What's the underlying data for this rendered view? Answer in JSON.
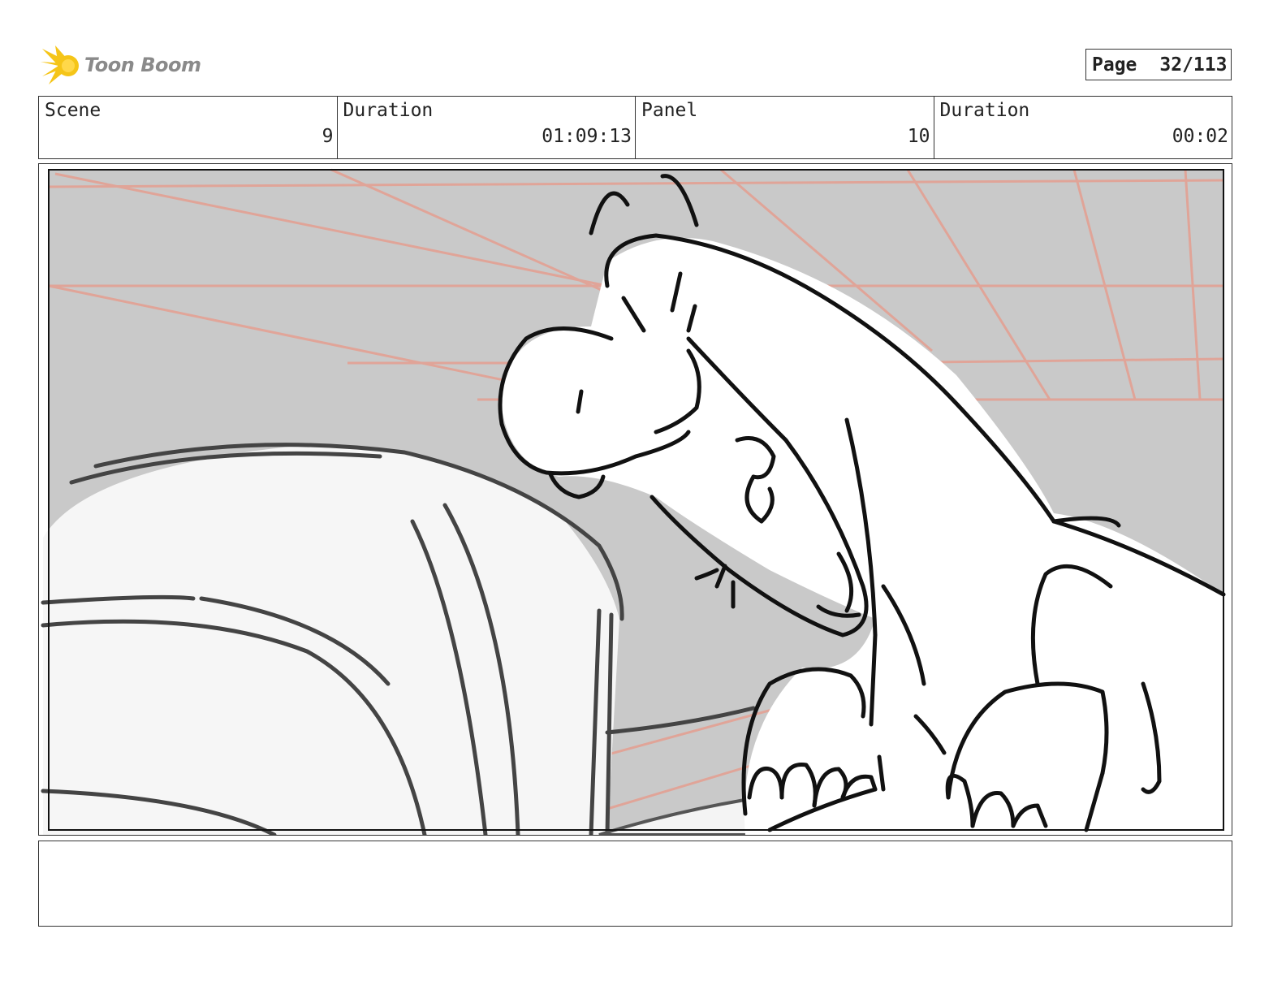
{
  "brand": {
    "logo_text": "Toon Boom",
    "accent": "#f5c518"
  },
  "page": {
    "label": "Page",
    "number": "32/113"
  },
  "info": [
    {
      "label": "Scene",
      "value": "9"
    },
    {
      "label": "Duration",
      "value": "01:09:13"
    },
    {
      "label": "Panel",
      "value": "10"
    },
    {
      "label": "Duration",
      "value": "00:02"
    }
  ],
  "panel_image": {
    "subject": "storyboard-sketch-dinosaur"
  },
  "notes": {
    "text": ""
  }
}
